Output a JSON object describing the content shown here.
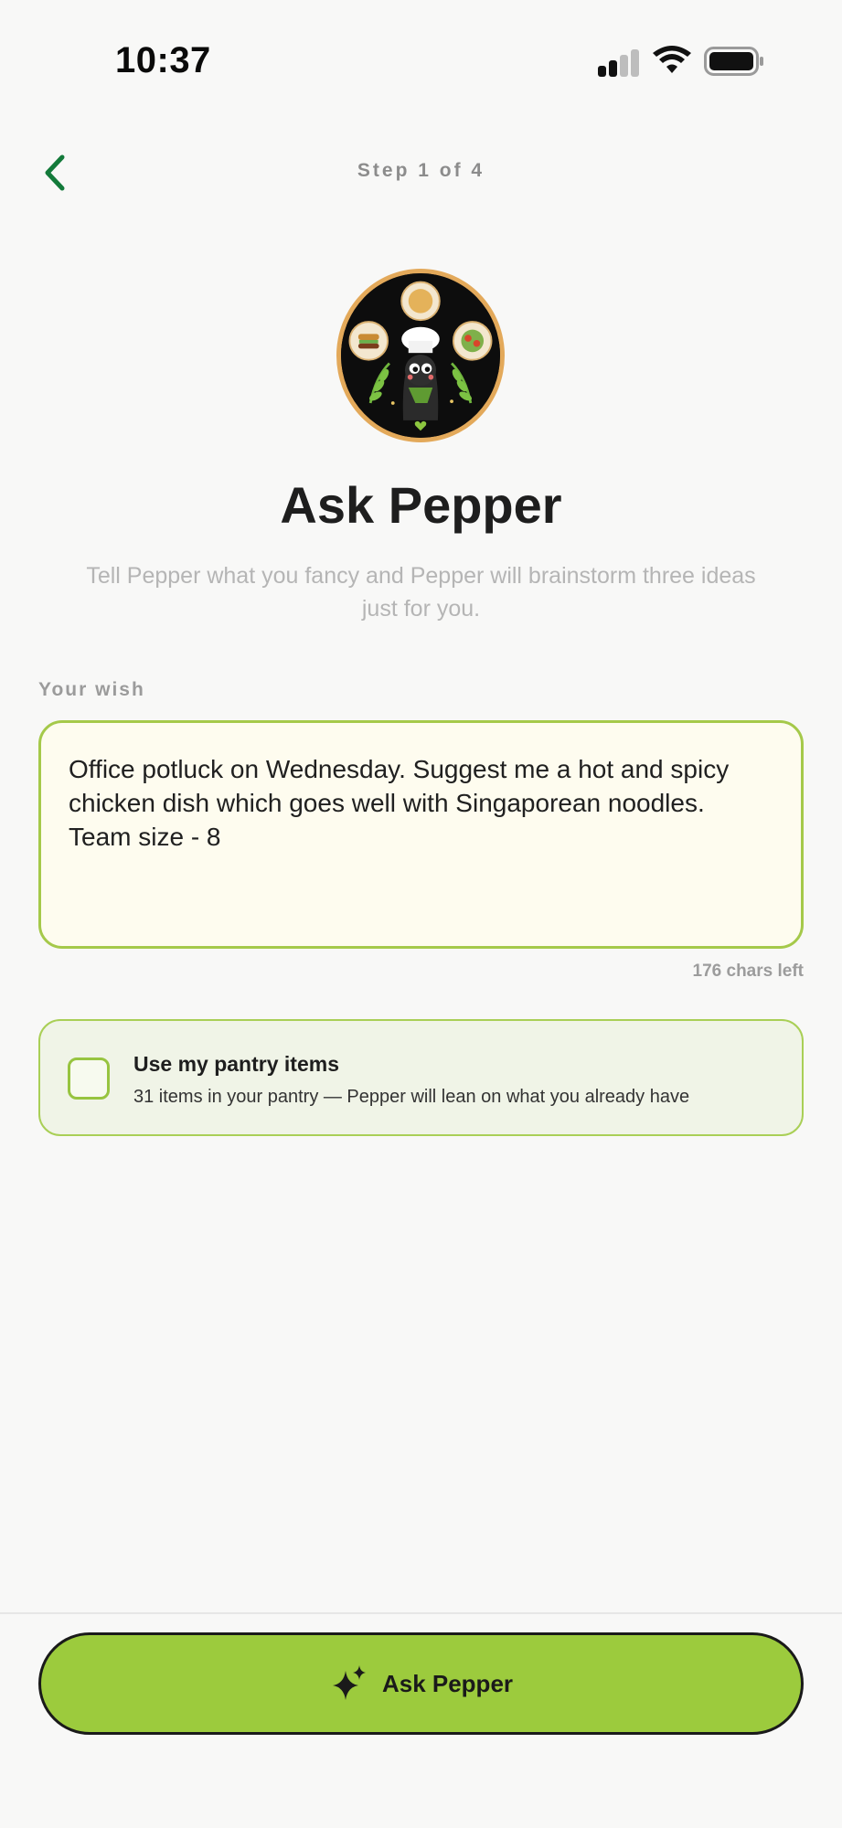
{
  "status_bar": {
    "time": "10:37",
    "signal_icon": "cellular-signal-icon",
    "wifi_icon": "wifi-icon",
    "battery_icon": "battery-icon"
  },
  "header": {
    "back_icon": "chevron-left-icon",
    "step_label": "Step 1 of 4"
  },
  "hero": {
    "avatar_icon": "pepper-chef-avatar",
    "title": "Ask Pepper",
    "subtitle": "Tell Pepper what you fancy and Pepper will brainstorm three ideas just for you."
  },
  "wish": {
    "label": "Your wish",
    "value": "Office potluck on Wednesday. Suggest me a hot and spicy chicken dish which goes well with Singaporean noodles. Team size - 8",
    "chars_left": "176 chars left"
  },
  "pantry": {
    "title": "Use my pantry items",
    "description": "31 items in your pantry — Pepper will lean on what you already have",
    "checked": false
  },
  "footer": {
    "button_label": "Ask Pepper",
    "button_icon": "sparkle-icon"
  },
  "colors": {
    "accent_green": "#9ccb3d",
    "back_arrow_green": "#137a3a",
    "wish_border": "#a5c94a",
    "wish_background": "#fefcef",
    "pantry_background": "#f0f4e7"
  }
}
